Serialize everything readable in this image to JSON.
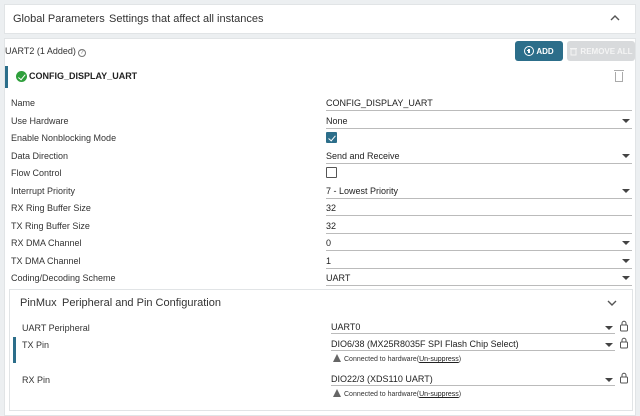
{
  "global": {
    "title": "Global Parameters",
    "subtitle": "Settings that affect all instances"
  },
  "uart": {
    "title": "UART2 (1 Added)",
    "add_label": "ADD",
    "remove_label": "REMOVE ALL"
  },
  "instance": {
    "name": "CONFIG_DISPLAY_UART"
  },
  "fields": [
    {
      "label": "Name",
      "value": "CONFIG_DISPLAY_UART",
      "type": "text"
    },
    {
      "label": "Use Hardware",
      "value": "None",
      "type": "select"
    },
    {
      "label": "Enable Nonblocking Mode",
      "checked": true,
      "type": "checkbox"
    },
    {
      "label": "Data Direction",
      "value": "Send and Receive",
      "type": "select"
    },
    {
      "label": "Flow Control",
      "checked": false,
      "type": "checkbox"
    },
    {
      "label": "Interrupt Priority",
      "value": "7 - Lowest Priority",
      "type": "select"
    },
    {
      "label": "RX Ring Buffer Size",
      "value": "32",
      "type": "text"
    },
    {
      "label": "TX Ring Buffer Size",
      "value": "32",
      "type": "text"
    },
    {
      "label": "RX DMA Channel",
      "value": "0",
      "type": "select"
    },
    {
      "label": "TX DMA Channel",
      "value": "1",
      "type": "select"
    },
    {
      "label": "Coding/Decoding Scheme",
      "value": "UART",
      "type": "select"
    }
  ],
  "pinmux": {
    "title": "PinMux",
    "subtitle": "Peripheral and Pin Configuration",
    "rows": [
      {
        "label": "UART Peripheral",
        "value": "UART0"
      },
      {
        "label": "TX Pin",
        "value": "DIO6/38 (MX25R8035F SPI Flash Chip Select)",
        "note": "Connected to hardware(",
        "link": "Un-suppress",
        "note_end": ")"
      },
      {
        "label": "RX Pin",
        "value": "DIO22/3 (XDS110 UART)",
        "note": "Connected to hardware(",
        "link": "Un-suppress",
        "note_end": ")"
      }
    ]
  }
}
